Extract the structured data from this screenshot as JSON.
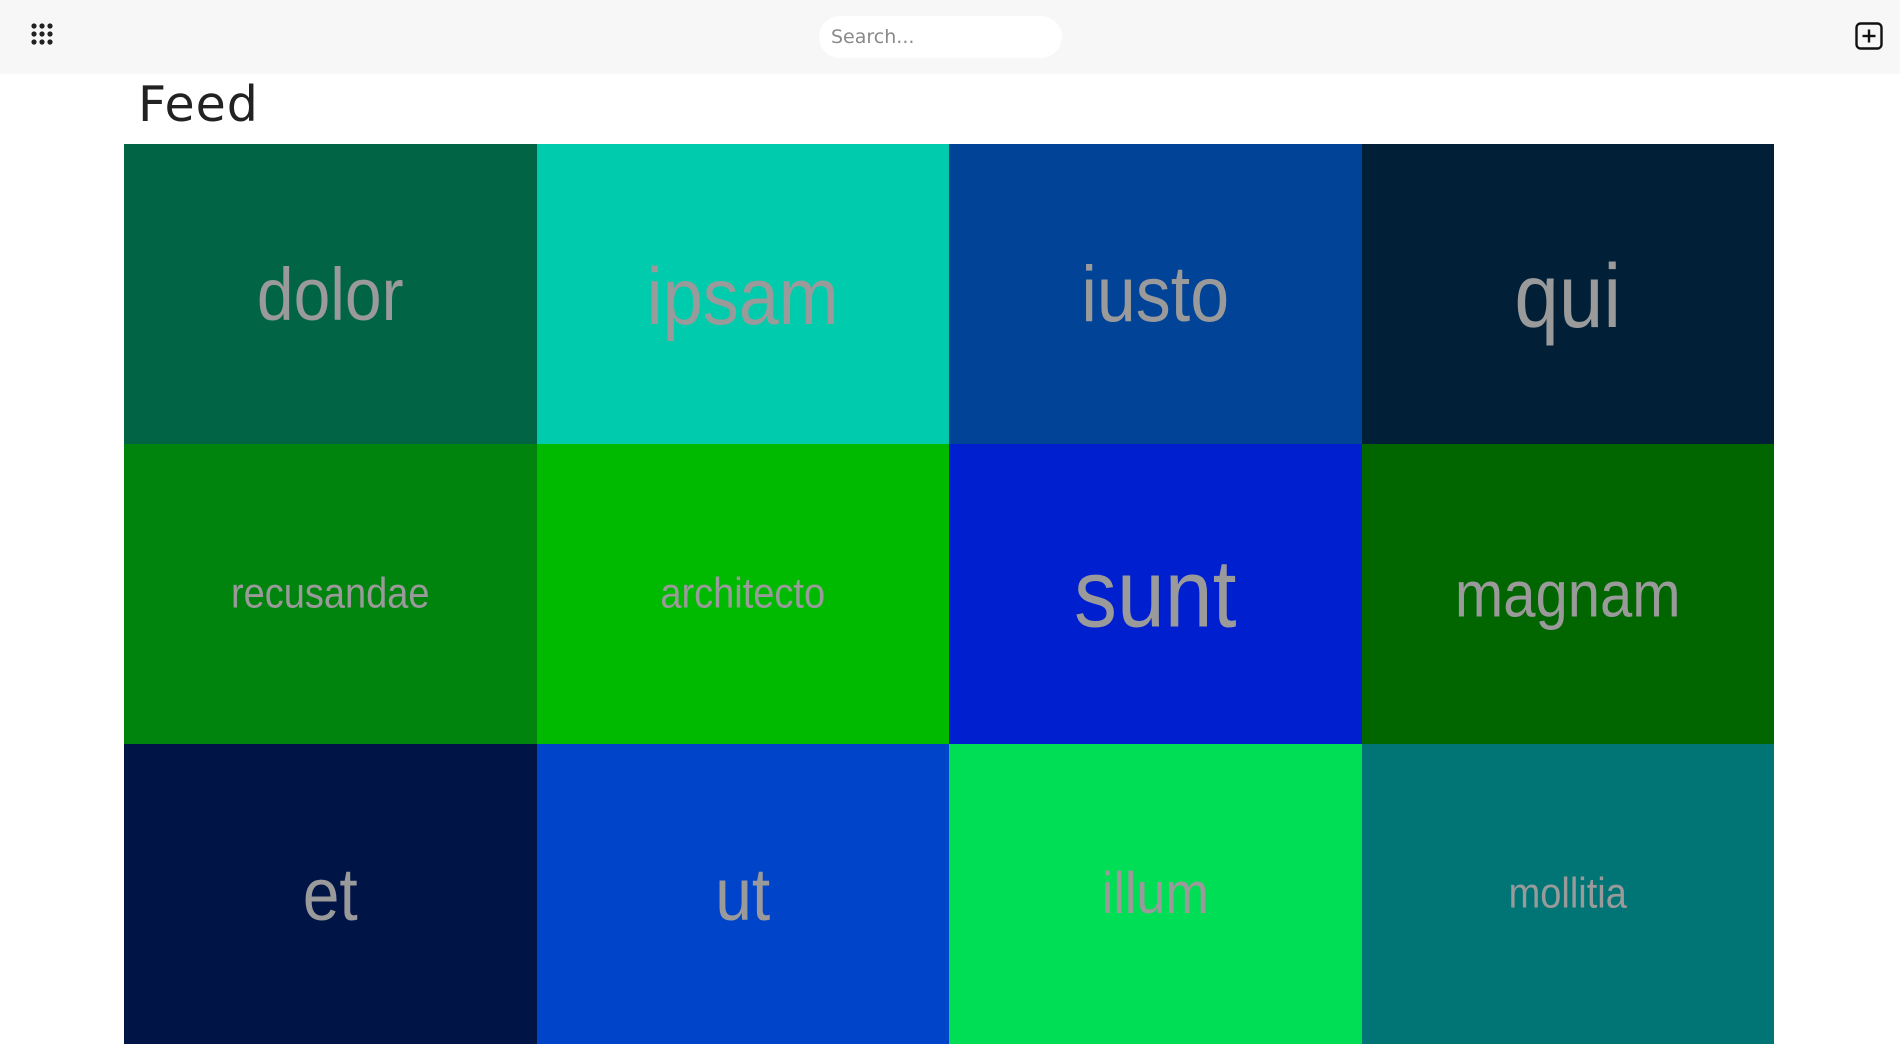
{
  "header": {
    "apps_icon": "grid-dots-icon",
    "search_placeholder": "Search...",
    "add_icon": "plus-square-icon"
  },
  "page": {
    "title": "Feed"
  },
  "feed": {
    "tiles": [
      {
        "label": "dolor",
        "color": "#016545"
      },
      {
        "label": "ipsam",
        "color": "#00CBAD"
      },
      {
        "label": "iusto",
        "color": "#014397"
      },
      {
        "label": "qui",
        "color": "#012038"
      },
      {
        "label": "recusandae",
        "color": "#00840D"
      },
      {
        "label": "architecto",
        "color": "#00BA00"
      },
      {
        "label": "sunt",
        "color": "#001FCF"
      },
      {
        "label": "magnam",
        "color": "#016500"
      },
      {
        "label": "et",
        "color": "#001446"
      },
      {
        "label": "ut",
        "color": "#0045C9"
      },
      {
        "label": "illum",
        "color": "#00DE55"
      },
      {
        "label": "mollitia",
        "color": "#017576"
      }
    ]
  }
}
